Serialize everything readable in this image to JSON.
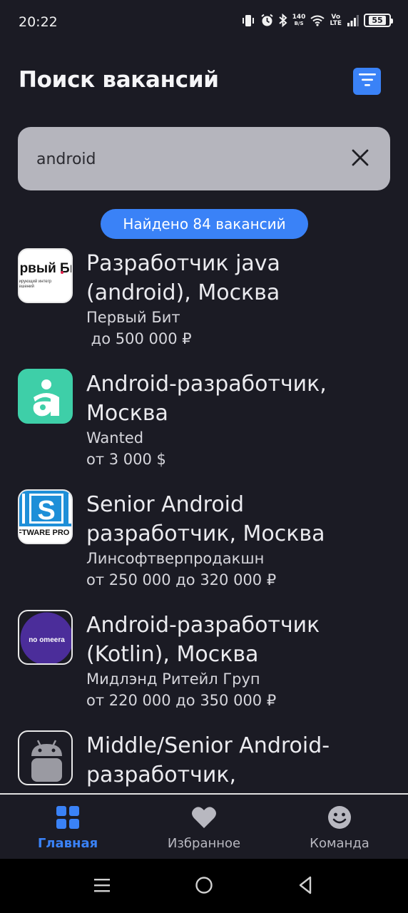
{
  "status_bar": {
    "time": "20:22",
    "net_speed_value": "140",
    "net_speed_unit": "B/S",
    "volte_top": "Vo",
    "volte_bottom": "LTE",
    "battery": "55"
  },
  "header": {
    "title": "Поиск вакансий",
    "filter_icon": "filter-icon"
  },
  "search": {
    "value": "android",
    "placeholder": ""
  },
  "results_badge": "Найдено 84 вакансий",
  "vacancies": [
    {
      "title": "Разработчик java (android), Москва",
      "company": "Первый Бит",
      "salary": " до 500 000 ₽",
      "logo_text": "Первый Бит",
      "logo_subtext": "Лидирующий интегратор решений"
    },
    {
      "title": "Android-разработчик, Москва",
      "company": "Wanted",
      "salary": "от 3 000 $",
      "logo_text": "a"
    },
    {
      "title": "Senior Android разработчик, Москва",
      "company": "Линсофтверпродакшн",
      "salary": "от 250 000 до 320 000 ₽",
      "logo_text": "S",
      "logo_subtext": "SOFTWARE PROD"
    },
    {
      "title": "Android-разработчик (Kotlin), Москва",
      "company": "Мидлэнд Ритейл Груп",
      "salary": "от 220 000 до 350 000 ₽",
      "logo_text": "no omeera"
    },
    {
      "title": "Middle/Senior Android-разработчик,",
      "company": "",
      "salary": "",
      "logo_text": ""
    }
  ],
  "bottom_nav": {
    "items": [
      {
        "label": "Главная",
        "icon": "grid-icon",
        "active": true
      },
      {
        "label": "Избранное",
        "icon": "heart-icon",
        "active": false
      },
      {
        "label": "Команда",
        "icon": "smile-icon",
        "active": false
      }
    ]
  },
  "colors": {
    "background": "#1b1b24",
    "accent": "#3a82f7",
    "search_bg": "#b5b5bd",
    "wanted_green": "#3ecfa8",
    "nomeera_purple": "#4b2d9a"
  }
}
